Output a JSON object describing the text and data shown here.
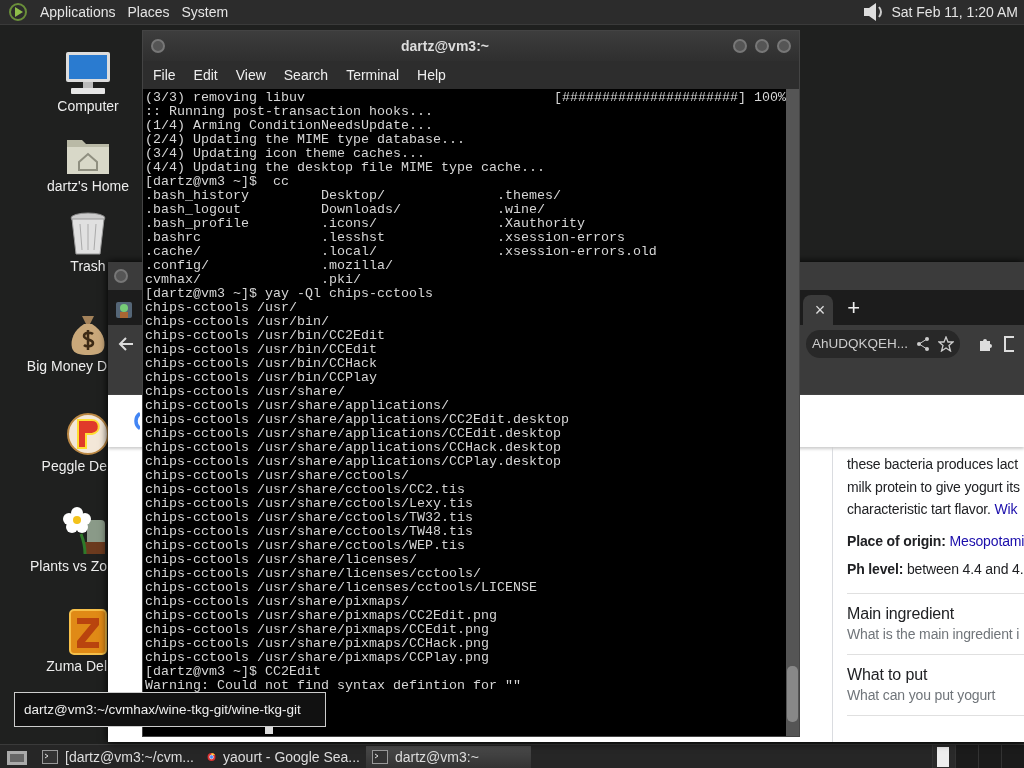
{
  "top_panel": {
    "menus": [
      "Applications",
      "Places",
      "System"
    ],
    "clock": "Sat Feb 11, 1:20 AM"
  },
  "desktop_icons": [
    {
      "kind": "computer",
      "label": "Computer",
      "cut": false
    },
    {
      "kind": "home",
      "label": "dartz's Home",
      "cut": false
    },
    {
      "kind": "trash",
      "label": "Trash",
      "cut": false
    },
    {
      "kind": "money",
      "label": "Big Money D",
      "cut": true
    },
    {
      "kind": "ball",
      "label": "Peggle De",
      "cut": true
    },
    {
      "kind": "plant",
      "label": "Plants vs Zo",
      "cut": true
    },
    {
      "kind": "block",
      "label": "Zuma Del",
      "cut": true
    }
  ],
  "browser": {
    "tabs": [
      {
        "selected": false
      },
      {
        "selected": true,
        "close": "×"
      }
    ],
    "new_tab": "+",
    "url": "AhUDQKQEH...",
    "panel": {
      "description_lines": [
        "these bacteria produces lact",
        "milk protein to give yogurt its",
        "characteristic tart flavor."
      ],
      "source_link": "Wik",
      "facts": [
        {
          "label": "Place of origin:",
          "value": "Mesopotami",
          "kind": "link"
        },
        {
          "label": "Ph level:",
          "value": "between 4.4 and 4.",
          "kind": "text"
        }
      ],
      "questions": [
        {
          "title": "Main ingredient",
          "subtitle": "What is the main ingredient i"
        },
        {
          "title": "What to put",
          "subtitle": "What can you put yogurt"
        }
      ]
    }
  },
  "terminal": {
    "title": "dartz@vm3:~",
    "menus": [
      "File",
      "Edit",
      "View",
      "Search",
      "Terminal",
      "Help"
    ],
    "lines": [
      {
        "kind": "progress",
        "text": "(3/3) removing libuv",
        "bar": "[######################] 100%"
      },
      {
        "kind": "text",
        "text": ":: Running post-transaction hooks..."
      },
      {
        "kind": "text",
        "text": "(1/4) Arming ConditionNeedsUpdate..."
      },
      {
        "kind": "text",
        "text": "(2/4) Updating the MIME type database..."
      },
      {
        "kind": "text",
        "text": "(3/4) Updating icon theme caches..."
      },
      {
        "kind": "text",
        "text": "(4/4) Updating the desktop file MIME type cache..."
      },
      {
        "kind": "text",
        "text": "[dartz@vm3 ~]$  cc"
      },
      {
        "kind": "columns",
        "cells": [
          ".bash_history",
          "Desktop/",
          ".themes/"
        ]
      },
      {
        "kind": "columns",
        "cells": [
          ".bash_logout",
          "Downloads/",
          ".wine/"
        ]
      },
      {
        "kind": "columns",
        "cells": [
          ".bash_profile",
          ".icons/",
          ".Xauthority"
        ]
      },
      {
        "kind": "columns",
        "cells": [
          ".bashrc",
          ".lesshst",
          ".xsession-errors"
        ]
      },
      {
        "kind": "columns",
        "cells": [
          ".cache/",
          ".local/",
          ".xsession-errors.old"
        ]
      },
      {
        "kind": "columns",
        "cells": [
          ".config/",
          ".mozilla/"
        ]
      },
      {
        "kind": "columns",
        "cells": [
          "cvmhax/",
          ".pki/"
        ]
      },
      {
        "kind": "text",
        "text": "[dartz@vm3 ~]$ yay -Ql chips-cctools"
      },
      {
        "kind": "text",
        "text": "chips-cctools /usr/"
      },
      {
        "kind": "text",
        "text": "chips-cctools /usr/bin/"
      },
      {
        "kind": "text",
        "text": "chips-cctools /usr/bin/CC2Edit"
      },
      {
        "kind": "text",
        "text": "chips-cctools /usr/bin/CCEdit"
      },
      {
        "kind": "text",
        "text": "chips-cctools /usr/bin/CCHack"
      },
      {
        "kind": "text",
        "text": "chips-cctools /usr/bin/CCPlay"
      },
      {
        "kind": "text",
        "text": "chips-cctools /usr/share/"
      },
      {
        "kind": "text",
        "text": "chips-cctools /usr/share/applications/"
      },
      {
        "kind": "text",
        "text": "chips-cctools /usr/share/applications/CC2Edit.desktop"
      },
      {
        "kind": "text",
        "text": "chips-cctools /usr/share/applications/CCEdit.desktop"
      },
      {
        "kind": "text",
        "text": "chips-cctools /usr/share/applications/CCHack.desktop"
      },
      {
        "kind": "text",
        "text": "chips-cctools /usr/share/applications/CCPlay.desktop"
      },
      {
        "kind": "text",
        "text": "chips-cctools /usr/share/cctools/"
      },
      {
        "kind": "text",
        "text": "chips-cctools /usr/share/cctools/CC2.tis"
      },
      {
        "kind": "text",
        "text": "chips-cctools /usr/share/cctools/Lexy.tis"
      },
      {
        "kind": "text",
        "text": "chips-cctools /usr/share/cctools/TW32.tis"
      },
      {
        "kind": "text",
        "text": "chips-cctools /usr/share/cctools/TW48.tis"
      },
      {
        "kind": "text",
        "text": "chips-cctools /usr/share/cctools/WEP.tis"
      },
      {
        "kind": "text",
        "text": "chips-cctools /usr/share/licenses/"
      },
      {
        "kind": "text",
        "text": "chips-cctools /usr/share/licenses/cctools/"
      },
      {
        "kind": "text",
        "text": "chips-cctools /usr/share/licenses/cctools/LICENSE"
      },
      {
        "kind": "text",
        "text": "chips-cctools /usr/share/pixmaps/"
      },
      {
        "kind": "text",
        "text": "chips-cctools /usr/share/pixmaps/CC2Edit.png"
      },
      {
        "kind": "text",
        "text": "chips-cctools /usr/share/pixmaps/CCEdit.png"
      },
      {
        "kind": "text",
        "text": "chips-cctools /usr/share/pixmaps/CCHack.png"
      },
      {
        "kind": "text",
        "text": "chips-cctools /usr/share/pixmaps/CCPlay.png"
      },
      {
        "kind": "text",
        "text": "[dartz@vm3 ~]$ CC2Edit"
      },
      {
        "kind": "text",
        "text": "Warning: Could not find syntax defintion for \"\""
      },
      {
        "kind": "blank"
      },
      {
        "kind": "blank"
      },
      {
        "kind": "input"
      }
    ]
  },
  "tooltip": "dartz@vm3:~/cvmhax/wine-tkg-git/wine-tkg-git",
  "taskbar": {
    "items": [
      {
        "kind": "terminal",
        "label": "[dartz@vm3:~/cvm...",
        "selected": false
      },
      {
        "kind": "browser",
        "label": "yaourt - Google Sea...",
        "selected": false
      },
      {
        "kind": "terminal",
        "label": "dartz@vm3:~",
        "selected": true
      }
    ]
  }
}
